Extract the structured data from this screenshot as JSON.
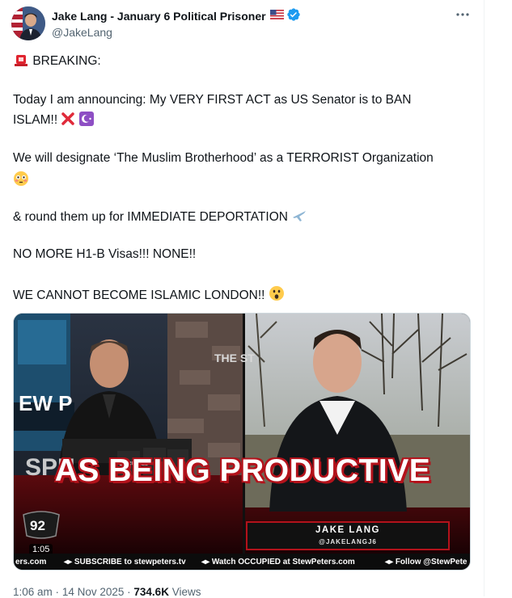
{
  "author": {
    "display_name": "Jake Lang - January 6 Political Prisoner",
    "handle": "@JakeLang",
    "flag_icon": "us-flag-icon",
    "verified_icon": "verified-badge-icon"
  },
  "post": {
    "line_breaking": "BREAKING:",
    "line_announce_1": "Today I am announcing: My VERY FIRST ACT as US Senator is to BAN",
    "line_announce_2": "ISLAM!!",
    "line_designate": "We will designate ‘The Muslim Brotherhood’ as a TERRORIST Organization",
    "line_roundup": "& round them up for IMMEDIATE DEPORTATION",
    "line_visas": "NO MORE H1-B Visas!!! NONE!!",
    "line_london": "WE CANNOT BECOME ISLAMIC LONDON!!",
    "emojis": [
      "police-light-emoji",
      "cross-mark-emoji",
      "crescent-emoji",
      "flushed-face-emoji",
      "airplane-emoji",
      "astonished-face-emoji"
    ]
  },
  "media": {
    "caption": "AS BEING PRODUCTIVE",
    "nameplate_name": "JAKE LANG",
    "nameplate_handle": "@JAKELANGJ6",
    "duration": "1:05",
    "ticker_left": "ers.com",
    "ticker_1": "SUBSCRIBE to stewpeters.tv",
    "ticker_2": "Watch OCCUPIED at StewPeters.com",
    "ticker_3": "Follow @StewPete",
    "backdrop_text": "THE ST",
    "studio_sign": "EW P",
    "occupied_label": "OCCUPIED",
    "logo_text": "SPN"
  },
  "meta": {
    "time": "1:06 am",
    "separator": "·",
    "date": "14 Nov 2025",
    "views_count": "734.6K",
    "views_label": "Views"
  },
  "colors": {
    "text": "#0f1419",
    "secondary": "#536471",
    "verified": "#1d9bf0",
    "caption_red": "#b3121b"
  }
}
